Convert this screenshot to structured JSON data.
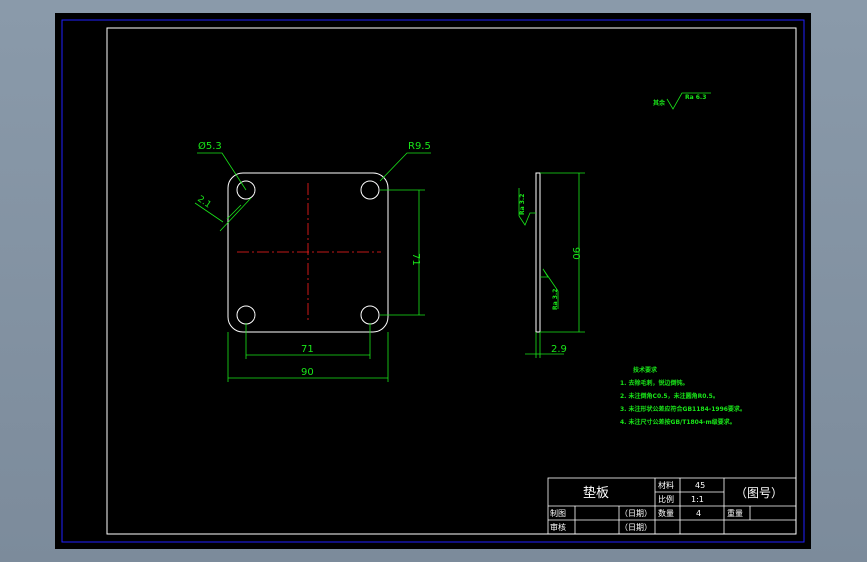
{
  "drawing": {
    "roughness_note": {
      "prefix": "其余",
      "value": "Ra 6.3"
    },
    "plate": {
      "corner_radius_label": "R9.5",
      "hole_label": "Ø5.3",
      "chamfer_label": "2.1",
      "hole_spacing_v": "71",
      "hole_spacing_h": "71",
      "overall_width": "90"
    },
    "side_view": {
      "height": "90",
      "thickness": "2.9",
      "roughness_top": "Ra 3.2",
      "roughness_bottom": "Ra 3.2"
    },
    "tech_requirements": {
      "title": "技术要求",
      "items": [
        "1. 去除毛刺，锐边倒钝。",
        "2. 未注倒角C0.5，未注圆角R0.5。",
        "3. 未注形状公差应符合GB1184-1996要求。",
        "4. 未注尺寸公差按GB/T1804-m级要求。"
      ]
    },
    "title_block": {
      "part_name": "垫板",
      "material_label": "材料",
      "material_value": "45",
      "scale_label": "比例",
      "scale_value": "1:1",
      "quantity_label": "数量",
      "quantity_value": "4",
      "weight_label": "重量",
      "drawing_no": "（图号）",
      "drawn_label": "制图",
      "checked_label": "审核",
      "date_1": "（日期）",
      "date_2": "（日期）"
    }
  },
  "colors": {
    "background": "#000000",
    "frame": "#2020ff",
    "geometry": "#ffffff",
    "centerline": "#ff2020",
    "dimension": "#19e619"
  }
}
